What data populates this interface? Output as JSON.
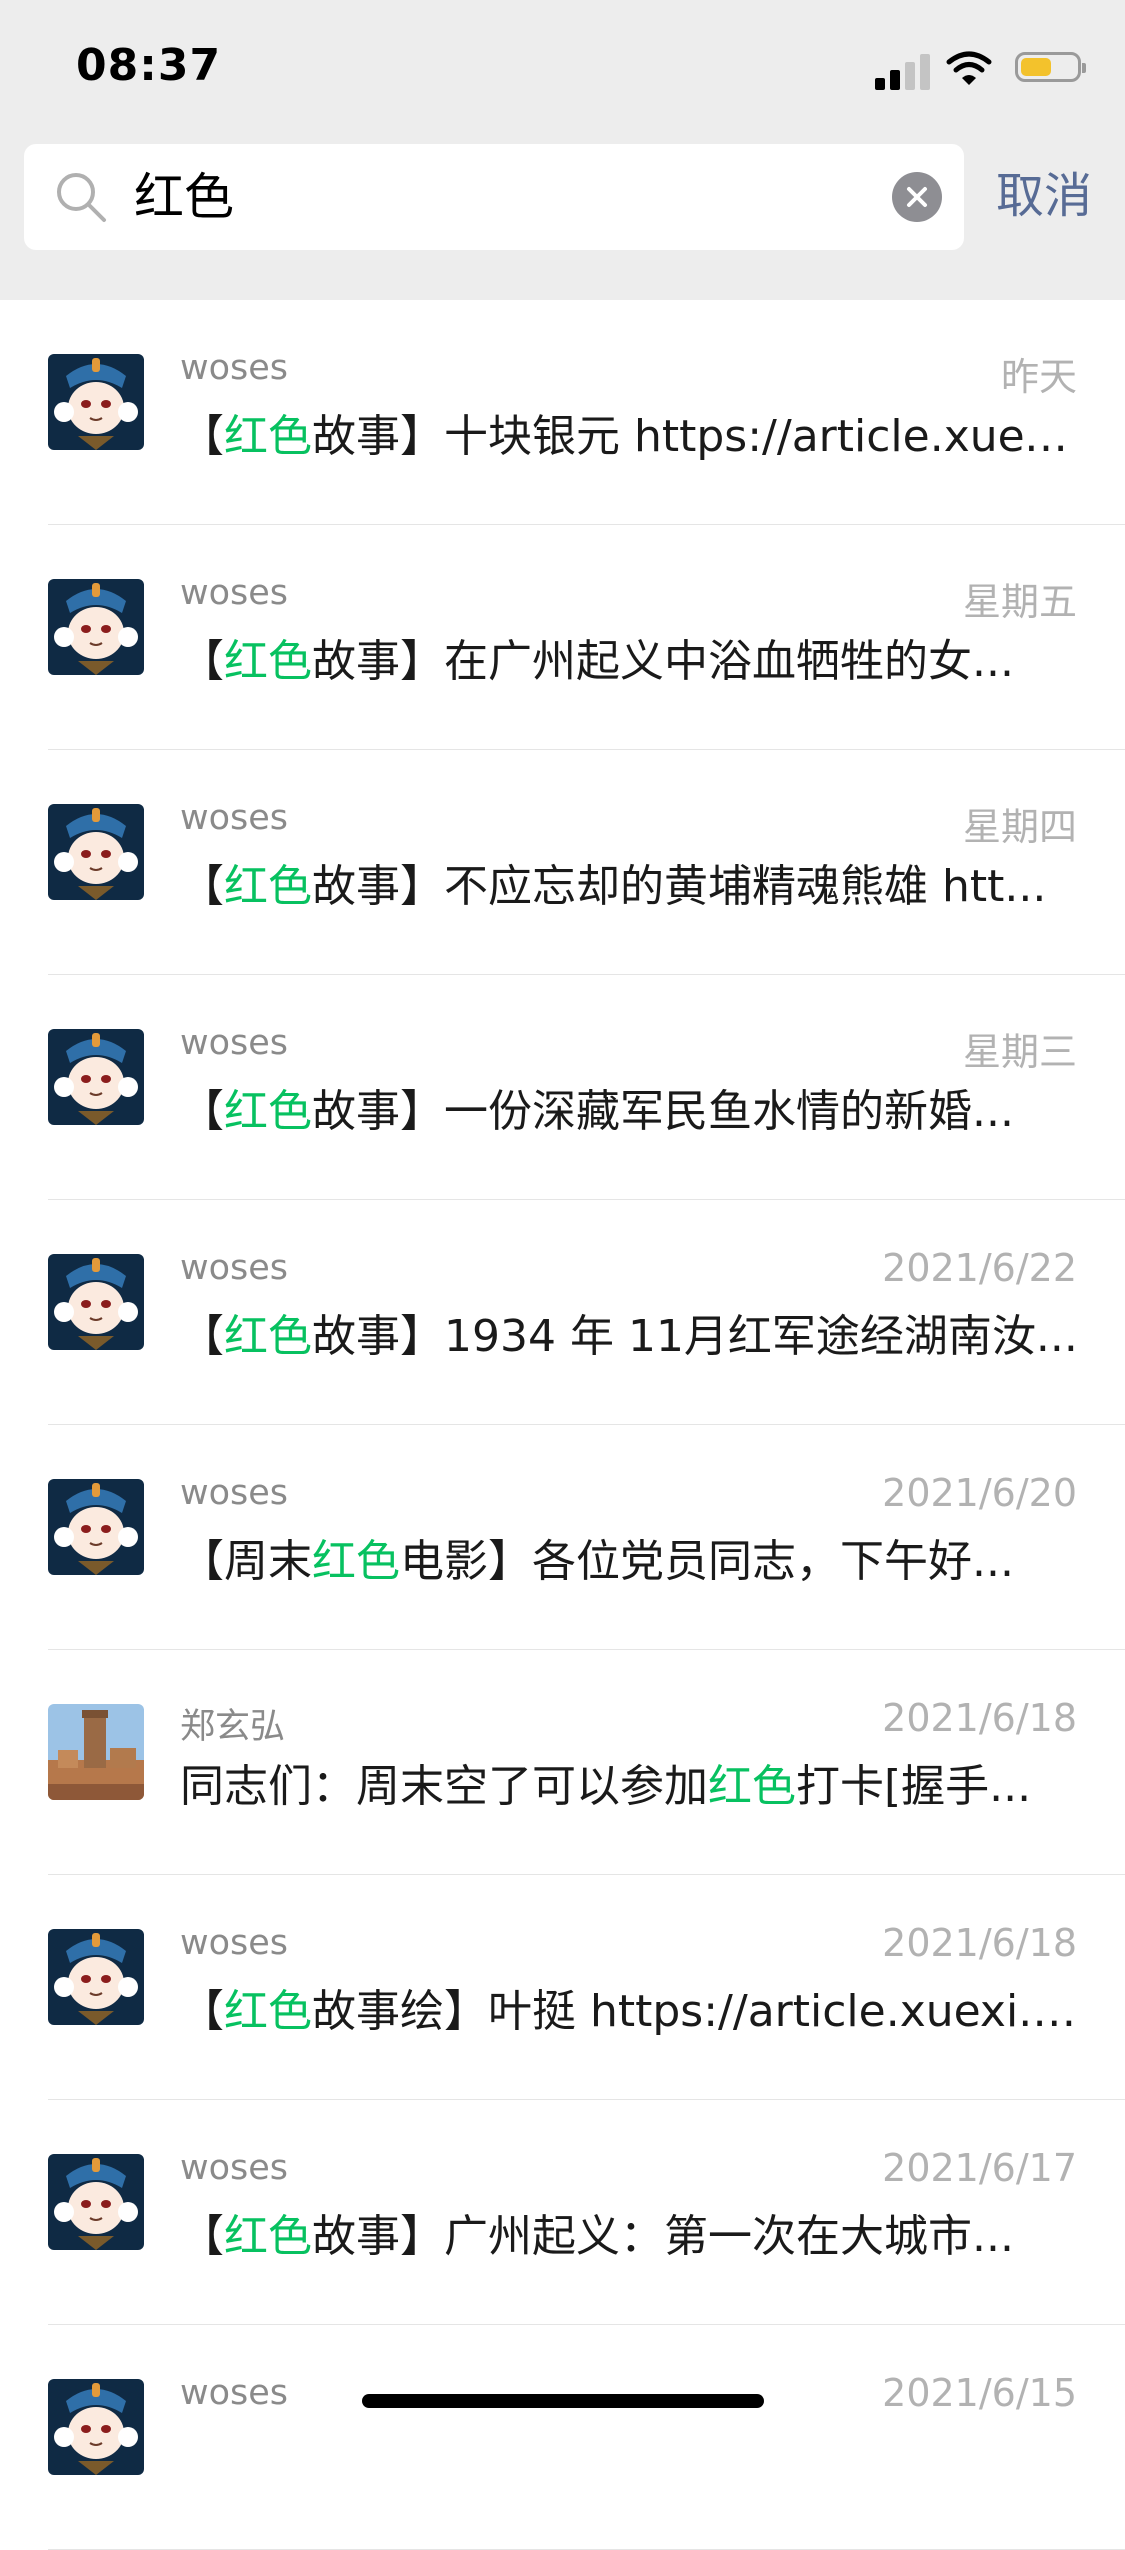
{
  "status_bar": {
    "time": "08:37"
  },
  "search": {
    "query": "红色",
    "cancel_label": "取消"
  },
  "results": [
    {
      "sender": "woses",
      "date": "昨天",
      "avatar": "cartoon",
      "pre": "【",
      "hl": "红色",
      "post": "故事】十块银元 https://article.xuexi..."
    },
    {
      "sender": "woses",
      "date": "星期五",
      "avatar": "cartoon",
      "pre": "【",
      "hl": "红色",
      "post": "故事】在广州起义中浴血牺牲的女..."
    },
    {
      "sender": "woses",
      "date": "星期四",
      "avatar": "cartoon",
      "pre": "【",
      "hl": "红色",
      "post": "故事】不应忘却的黄埔精魂熊雄 htt..."
    },
    {
      "sender": "woses",
      "date": "星期三",
      "avatar": "cartoon",
      "pre": "【",
      "hl": "红色",
      "post": "故事】一份深藏军民鱼水情的新婚..."
    },
    {
      "sender": "woses",
      "date": "2021/6/22",
      "avatar": "cartoon",
      "pre": "【",
      "hl": "红色",
      "post": "故事】1934 年 11月红军途经湖南汝..."
    },
    {
      "sender": "woses",
      "date": "2021/6/20",
      "avatar": "cartoon",
      "pre": "【周末",
      "hl": "红色",
      "post": "电影】各位党员同志，下午好..."
    },
    {
      "sender": "郑玄弘",
      "date": "2021/6/18",
      "avatar": "photo",
      "pre": "同志们：周末空了可以参加",
      "hl": "红色",
      "post": "打卡[握手..."
    },
    {
      "sender": "woses",
      "date": "2021/6/18",
      "avatar": "cartoon",
      "pre": "【",
      "hl": "红色",
      "post": "故事绘】叶挺 https://article.xuexi.c..."
    },
    {
      "sender": "woses",
      "date": "2021/6/17",
      "avatar": "cartoon",
      "pre": "【",
      "hl": "红色",
      "post": "故事】广州起义：第一次在大城市..."
    },
    {
      "sender": "woses",
      "date": "2021/6/15",
      "avatar": "cartoon",
      "pre": "",
      "hl": "",
      "post": ""
    }
  ],
  "colors": {
    "highlight": "#07c160",
    "cancel": "#576b95",
    "battery": "#f3c22c"
  },
  "icons": {
    "search": "search-icon",
    "clear": "clear-icon",
    "signal": "signal-icon",
    "wifi": "wifi-icon",
    "battery": "battery-icon"
  },
  "battery_level": 0.55
}
